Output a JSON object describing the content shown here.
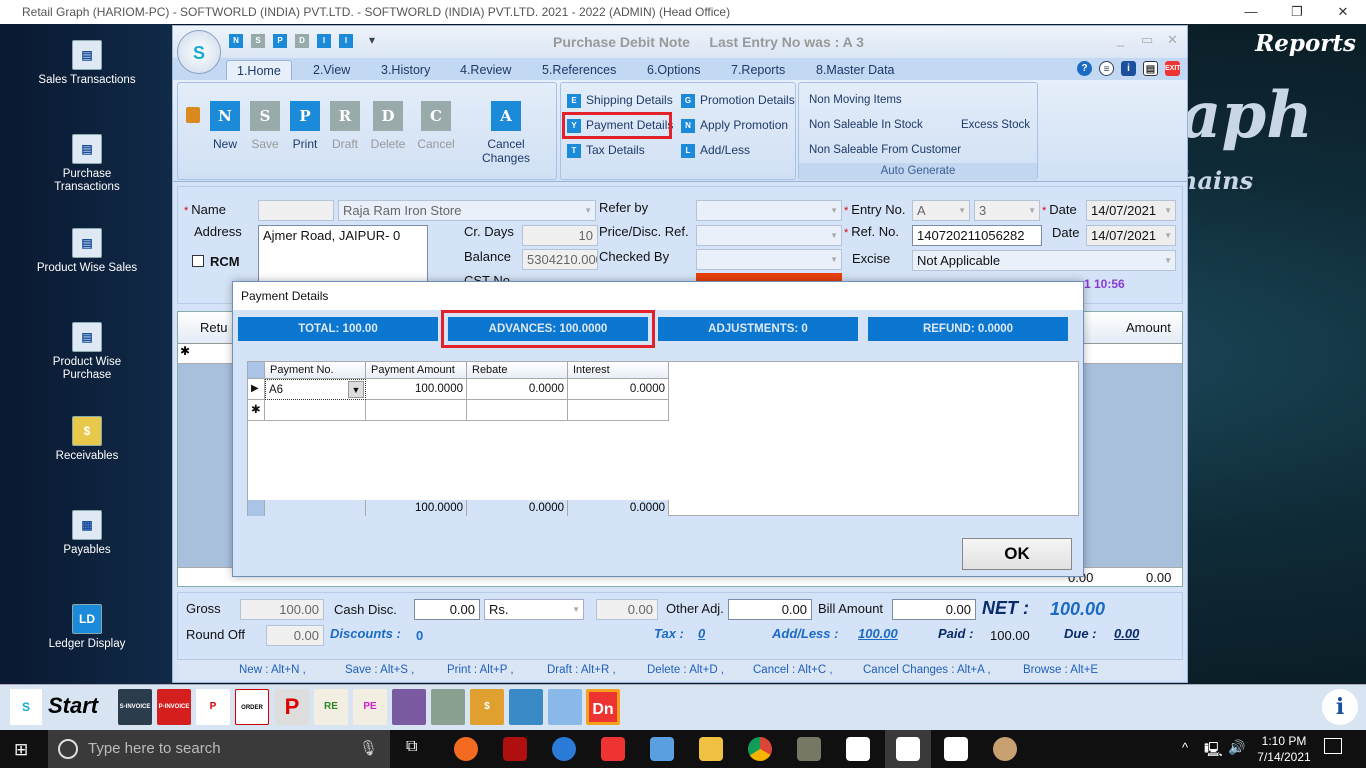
{
  "window_title": "Retail Graph (HARIOM-PC) - SOFTWORLD (INDIA) PVT.LTD. - SOFTWORLD (INDIA) PVT.LTD.  2021 - 2022 (ADMIN) (Head Office)",
  "desktop": {
    "icons": [
      {
        "label": "Sales Transactions"
      },
      {
        "label": "Purchase Transactions"
      },
      {
        "label": "Product Wise Sales"
      },
      {
        "label": "Product Wise Purchase"
      },
      {
        "label": "Receivables"
      },
      {
        "label": "Payables"
      },
      {
        "label": "Ledger Display"
      }
    ],
    "reports_label": "Reports",
    "bg_logo_1": "aph",
    "bg_logo_2": "hains"
  },
  "app": {
    "title": "Purchase Debit Note",
    "last_entry": "Last Entry No was : A 3",
    "logo_text": "S",
    "quick_access": [
      "N",
      "S",
      "P",
      "D",
      "I",
      "I"
    ],
    "tabs": [
      "1.Home",
      "2.View",
      "3.History",
      "4.Review",
      "5.References",
      "6.Options",
      "7.Reports",
      "8.Master Data"
    ],
    "ribbon": {
      "big_buttons": [
        {
          "label": "New",
          "icon": "N",
          "enabled": true
        },
        {
          "label": "Save",
          "icon": "S",
          "enabled": false
        },
        {
          "label": "Print",
          "icon": "P",
          "enabled": true
        },
        {
          "label": "Draft",
          "icon": "R",
          "enabled": false
        },
        {
          "label": "Delete",
          "icon": "D",
          "enabled": false
        },
        {
          "label": "Cancel",
          "icon": "C",
          "enabled": false
        },
        {
          "label": "Cancel Changes",
          "icon": "A",
          "enabled": true
        }
      ],
      "details": [
        {
          "label": "Shipping Details",
          "icon": "E"
        },
        {
          "label": "Payment Details",
          "icon": "Y"
        },
        {
          "label": "Tax Details",
          "icon": "T"
        },
        {
          "label": "Promotion Details",
          "icon": "G"
        },
        {
          "label": "Apply Promotion",
          "icon": "N"
        },
        {
          "label": "Add/Less",
          "icon": "L"
        }
      ],
      "auto_generate": {
        "items": [
          "Non Moving Items",
          "Non Saleable In Stock",
          "Non Saleable From Customer",
          "Excess Stock"
        ],
        "group_label": "Auto Generate"
      }
    },
    "form": {
      "name_label": "Name",
      "name_value": "Raja Ram Iron Store",
      "address_label": "Address",
      "address_value": "Ajmer Road, JAIPUR- 0",
      "rcm_label": "RCM",
      "cr_days_label": "Cr. Days",
      "cr_days_value": "10",
      "balance_label": "Balance",
      "balance_value": "5304210.000",
      "cst_label": "CST No.",
      "refer_by_label": "Refer by",
      "price_ref_label": "Price/Disc. Ref.",
      "checked_by_label": "Checked By",
      "entry_no_label": "Entry No.",
      "entry_series": "A",
      "entry_no": "3",
      "date_label": "Date",
      "date_value": "14/07/2021",
      "ref_no_label": "Ref. No.",
      "ref_no_value": "140720211056282",
      "ref_date_value": "14/07/2021",
      "excise_label": "Excise",
      "excise_value": "Not Applicable",
      "timestamp": "1 10:56"
    },
    "grid": {
      "col_first": "Retu",
      "col_qty": "ty",
      "col_amount": "Amount",
      "footer_qty": "0.00",
      "footer_amount": "0.00"
    },
    "totals": {
      "gross_label": "Gross",
      "gross_value": "100.00",
      "cash_disc_label": "Cash Disc.",
      "cash_disc_value": "0.00",
      "cash_disc_unit": "Rs.",
      "cash_disc_amount": "0.00",
      "other_adj_label": "Other Adj.",
      "other_adj_value": "0.00",
      "bill_amount_label": "Bill Amount",
      "bill_amount_value": "0.00",
      "net_label": "NET :",
      "net_value": "100.00",
      "round_off_label": "Round Off",
      "round_off_value": "0.00",
      "discounts_label": "Discounts :",
      "discounts_value": "0",
      "tax_label": "Tax :",
      "tax_value": "0",
      "addless_label": "Add/Less :",
      "addless_value": "100.00",
      "paid_label": "Paid :",
      "paid_value": "100.00",
      "due_label": "Due :",
      "due_value": "0.00"
    },
    "shortcuts": [
      "New : Alt+N ,",
      "Save : Alt+S ,",
      "Print : Alt+P ,",
      "Draft : Alt+R ,",
      "Delete : Alt+D ,",
      "Cancel : Alt+C ,",
      "Cancel Changes : Alt+A ,",
      "Browse : Alt+E"
    ]
  },
  "dialog": {
    "title": "Payment Details",
    "summary": [
      "TOTAL: 100.00",
      "ADVANCES: 100.0000",
      "ADJUSTMENTS: 0",
      "REFUND: 0.0000"
    ],
    "columns": [
      "Payment No.",
      "Payment Amount",
      "Rebate",
      "Interest"
    ],
    "rows": [
      [
        "A6",
        "100.0000",
        "0.0000",
        "0.0000"
      ]
    ],
    "footer": [
      "100.0000",
      "0.0000",
      "0.0000"
    ],
    "ok_label": "OK"
  },
  "startbar": {
    "start_label": "Start",
    "icons": [
      "S-INVOICE",
      "P-INVOICE",
      "P",
      "ORDER BOOK",
      "P",
      "RE",
      "PE",
      "",
      "$",
      "",
      "",
      "",
      "Dn"
    ]
  },
  "taskbar": {
    "search_placeholder": "Type here to search",
    "time": "1:10 PM",
    "date": "7/14/2021"
  },
  "colors": {
    "accent": "#0b77d1",
    "highlight": "#e3212a"
  }
}
